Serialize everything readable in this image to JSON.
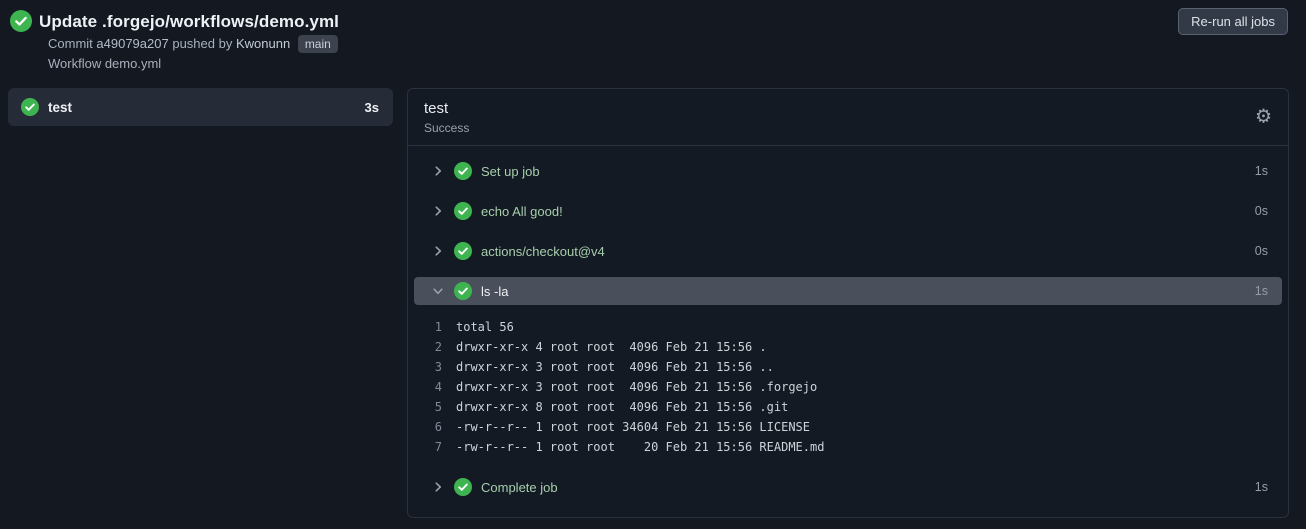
{
  "colors": {
    "success_green": "#3eb450",
    "page_bg": "#131821",
    "step_text_green": "#a6ceac"
  },
  "header": {
    "title": "Update .forgejo/workflows/demo.yml",
    "commit": {
      "label": "Commit",
      "sha": "a49079a207",
      "pushed_by": "pushed by",
      "author": "Kwonunn",
      "branch": "main"
    },
    "workflow_line": "Workflow demo.yml",
    "rerun_label": "Re-run all jobs"
  },
  "sidebar": {
    "jobs": [
      {
        "name": "test",
        "duration": "3s",
        "status": "success",
        "selected": true
      }
    ]
  },
  "job_panel": {
    "title": "test",
    "status": "Success",
    "gear_icon": "⚙",
    "steps": [
      {
        "name": "Set up job",
        "duration": "1s",
        "status": "success",
        "expanded": false
      },
      {
        "name": "echo All good!",
        "duration": "0s",
        "status": "success",
        "expanded": false
      },
      {
        "name": "actions/checkout@v4",
        "duration": "0s",
        "status": "success",
        "expanded": false
      },
      {
        "name": "ls -la",
        "duration": "1s",
        "status": "success",
        "expanded": true,
        "log_lines": [
          {
            "num": "1",
            "text": "total 56"
          },
          {
            "num": "2",
            "text": "drwxr-xr-x 4 root root  4096 Feb 21 15:56 ."
          },
          {
            "num": "3",
            "text": "drwxr-xr-x 3 root root  4096 Feb 21 15:56 .."
          },
          {
            "num": "4",
            "text": "drwxr-xr-x 3 root root  4096 Feb 21 15:56 .forgejo"
          },
          {
            "num": "5",
            "text": "drwxr-xr-x 8 root root  4096 Feb 21 15:56 .git"
          },
          {
            "num": "6",
            "text": "-rw-r--r-- 1 root root 34604 Feb 21 15:56 LICENSE"
          },
          {
            "num": "7",
            "text": "-rw-r--r-- 1 root root    20 Feb 21 15:56 README.md"
          }
        ]
      },
      {
        "name": "Complete job",
        "duration": "1s",
        "status": "success",
        "expanded": false
      }
    ]
  }
}
